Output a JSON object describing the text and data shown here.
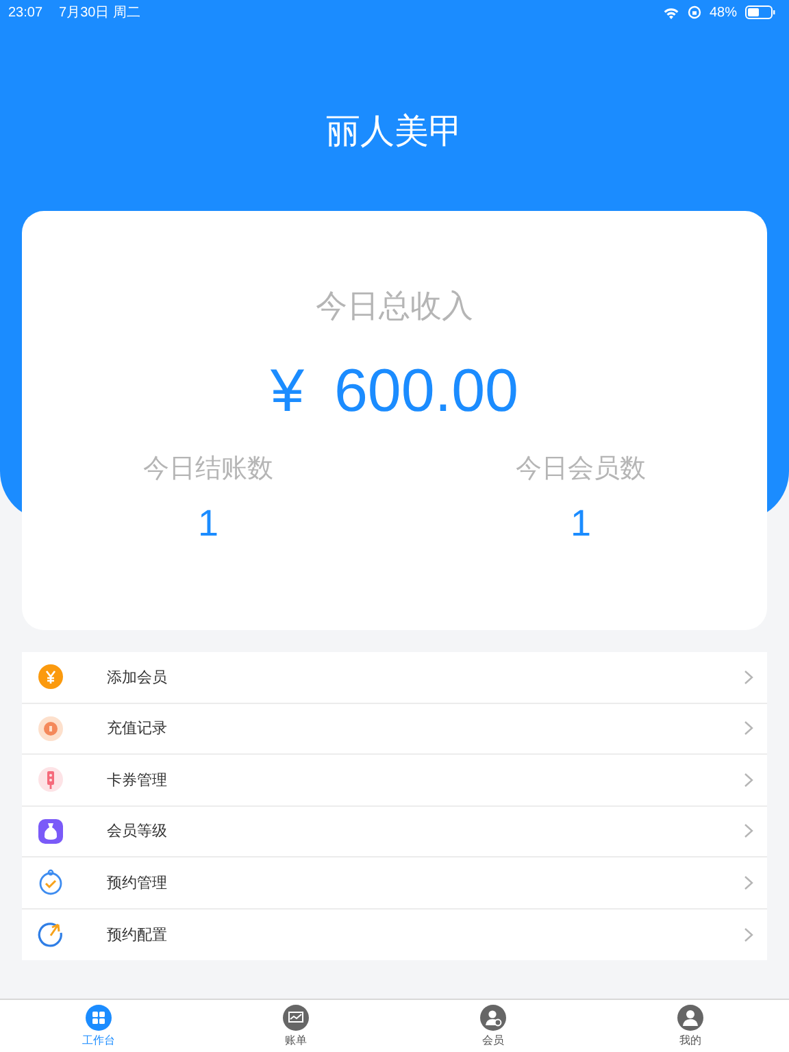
{
  "status_bar": {
    "time": "23:07",
    "date": "7月30日 周二",
    "battery": "48%"
  },
  "title": "丽人美甲",
  "summary": {
    "label": "今日总收入",
    "currency": "¥",
    "amount": "600.00",
    "stats": [
      {
        "label": "今日结账数",
        "value": "1"
      },
      {
        "label": "今日会员数",
        "value": "1"
      }
    ]
  },
  "menu": [
    {
      "label": "添加会员",
      "kind": "yen"
    },
    {
      "label": "充值记录",
      "kind": "coin"
    },
    {
      "label": "卡券管理",
      "kind": "ticket"
    },
    {
      "label": "会员等级",
      "kind": "bag"
    },
    {
      "label": "预约管理",
      "kind": "clock"
    },
    {
      "label": "预约配置",
      "kind": "arc"
    }
  ],
  "tabs": [
    {
      "label": "工作台",
      "kind": "grid",
      "selected": true
    },
    {
      "label": "账单",
      "kind": "chart",
      "selected": false
    },
    {
      "label": "会员",
      "kind": "member",
      "selected": false
    },
    {
      "label": "我的",
      "kind": "person",
      "selected": false
    }
  ]
}
